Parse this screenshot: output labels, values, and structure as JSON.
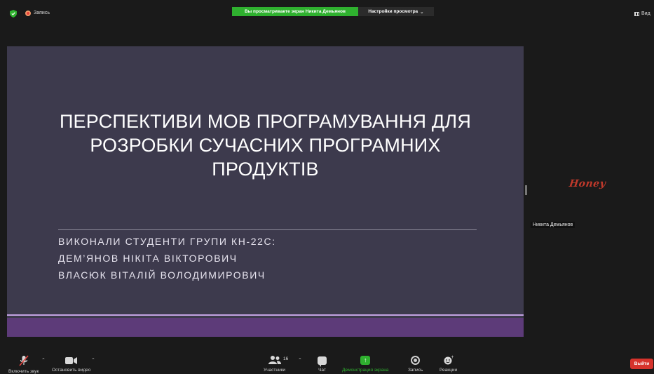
{
  "topbar": {
    "recording_label": "Запись",
    "share_banner": "Вы просматриваете экран Никита Демьянов",
    "view_options": "Настройки просмотра",
    "view_toggle_label": "Вид"
  },
  "slide": {
    "title_lines": [
      "ПЕРСПЕКТИВИ МОВ ПРОГРАМУВАННЯ ДЛЯ",
      "РОЗРОБКИ СУЧАСНИХ ПРОГРАМНИХ",
      "ПРОДУКТІВ"
    ],
    "subtitle_lines": [
      "ВИКОНАЛИ СТУДЕНТИ ГРУПИ КН-22С:",
      "ДЕМ’ЯНОВ НІКІТА ВІКТОРОВИЧ",
      "ВЛАСЮК ВІТАЛІЙ ВОЛОДИМИРОВИЧ"
    ],
    "colors": {
      "background": "#3d3a4d",
      "band": "#5d3b79",
      "band_line": "#c4a3e3"
    }
  },
  "participant": {
    "logo_text": "Honey",
    "name": "Никита Демьянов"
  },
  "toolbar": {
    "mute_label": "Включить звук",
    "video_label": "Остановить видео",
    "participants_label": "Участники",
    "participants_count": "16",
    "chat_label": "Чат",
    "share_label": "Демонстрация экрана",
    "record_label": "Запись",
    "reactions_label": "Реакции",
    "leave_label": "Выйти"
  },
  "colors": {
    "accent_green": "#2fb12f",
    "leave_red": "#d6332c",
    "recording_red": "#e8403a"
  }
}
